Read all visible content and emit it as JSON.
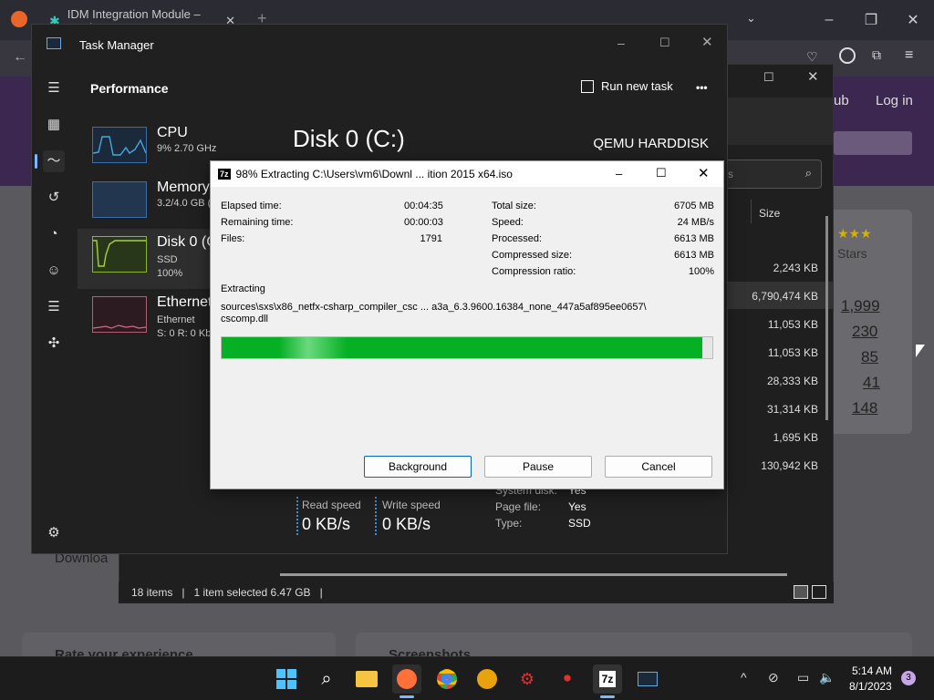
{
  "browser": {
    "tab_title": "IDM Integration Module – Get i",
    "right_text_login": "Log in",
    "right_text_sub": "ub"
  },
  "explorer": {
    "column_size": "Size",
    "sizes": [
      "2,243 KB",
      "6,790,474 KB",
      "11,053 KB",
      "11,053 KB",
      "28,333 KB",
      "31,314 KB",
      "1,695 KB",
      "130,942 KB"
    ],
    "search_placeholder": "s",
    "status_items": "18 items",
    "status_selected": "1 item selected  6.47 GB",
    "ratings": {
      "label": "Stars",
      "counts": [
        "1,999",
        "230",
        "85",
        "41",
        "148"
      ]
    },
    "page_bottom_left": "Rate your experience",
    "page_bottom_right": "Screenshots",
    "download_text": "Downloa"
  },
  "taskmanager": {
    "title": "Task Manager",
    "section": "Performance",
    "run_new_task": "Run new task",
    "more": "•••",
    "items": [
      {
        "name": "CPU",
        "sub1": "9% 2.70 GHz",
        "sub2": ""
      },
      {
        "name": "Memory",
        "sub1": "3.2/4.0 GB (",
        "sub2": ""
      },
      {
        "name": "Disk 0 (C",
        "sub1": "SSD",
        "sub2": "100%"
      },
      {
        "name": "Ethernet",
        "sub1": "Ethernet",
        "sub2": "S: 0 R: 0 Kb"
      }
    ],
    "disk_title": "Disk 0 (C:)",
    "disk_model": "QEMU HARDDISK",
    "read_label": "Read speed",
    "read_value": "0 KB/s",
    "write_label": "Write speed",
    "write_value": "0 KB/s",
    "props": [
      {
        "k": "System disk:",
        "v": "Yes"
      },
      {
        "k": "Page file:",
        "v": "Yes"
      },
      {
        "k": "Type:",
        "v": "SSD"
      }
    ]
  },
  "dialog": {
    "icon_text": "7z",
    "title": "98% Extracting C:\\Users\\vm6\\Downl ... ition 2015 x64.iso",
    "left": [
      {
        "k": "Elapsed time:",
        "v": "00:04:35"
      },
      {
        "k": "Remaining time:",
        "v": "00:00:03"
      },
      {
        "k": "Files:",
        "v": "1791"
      }
    ],
    "right": [
      {
        "k": "Total size:",
        "v": "6705 MB"
      },
      {
        "k": "Speed:",
        "v": "24 MB/s"
      },
      {
        "k": "Processed:",
        "v": "6613 MB"
      },
      {
        "k": "Compressed size:",
        "v": "6613 MB"
      },
      {
        "k": "Compression ratio:",
        "v": "100%"
      }
    ],
    "status": "Extracting",
    "path_line1": "sources\\sxs\\x86_netfx-csharp_compiler_csc ... a3a_6.3.9600.16384_none_447a5af895ee0657\\",
    "path_line2": "cscomp.dll",
    "progress": 0.98,
    "btn_background": "Background",
    "btn_pause": "Pause",
    "btn_cancel": "Cancel"
  },
  "taskbar": {
    "time": "5:14 AM",
    "date": "8/1/2023",
    "notif_count": "3"
  }
}
